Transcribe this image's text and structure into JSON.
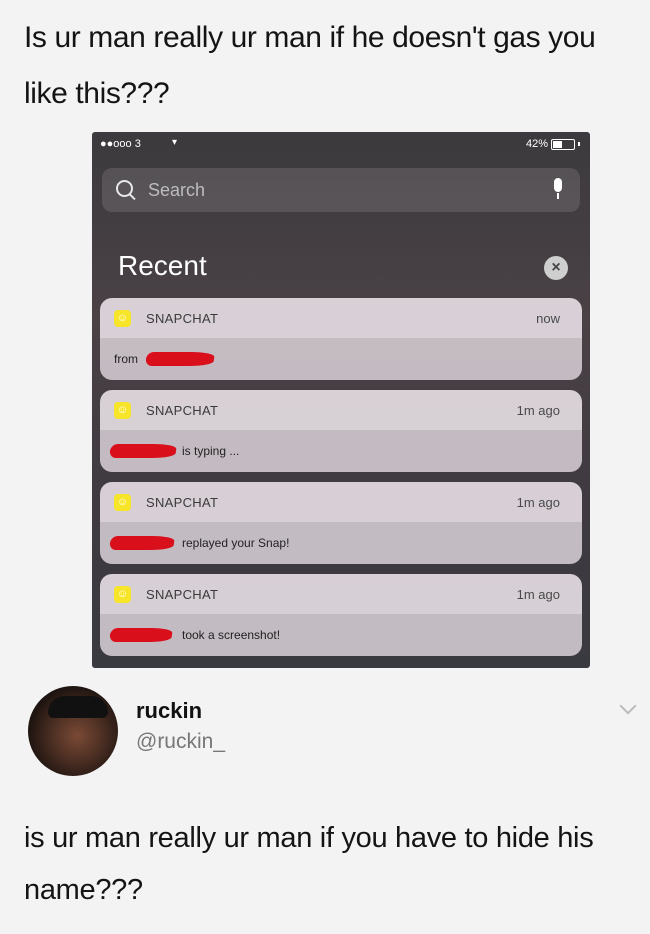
{
  "post": {
    "caption": "Is ur man really ur man if he doesn't gas you like this???"
  },
  "phone": {
    "status": {
      "carrier": "●●ooo 3",
      "battery": "42%"
    },
    "search": {
      "placeholder": "Search"
    },
    "section_title": "Recent",
    "notifications": [
      {
        "app": "SNAPCHAT",
        "time": "now",
        "message": "from"
      },
      {
        "app": "SNAPCHAT",
        "time": "1m ago",
        "message": "is typing ..."
      },
      {
        "app": "SNAPCHAT",
        "time": "1m ago",
        "message": "replayed your Snap!"
      },
      {
        "app": "SNAPCHAT",
        "time": "1m ago",
        "message": "took a screenshot!"
      }
    ]
  },
  "tweet": {
    "display_name": "ruckin",
    "handle": "@ruckin_",
    "text": "is ur man really ur man if you have to hide his name???"
  },
  "colors": {
    "snapchat_yellow": "#f7e52a",
    "redaction_red": "#d9101c"
  },
  "icons": [
    "search-icon",
    "mic-icon",
    "close-icon",
    "snapchat-icon",
    "chevron-down-icon"
  ]
}
